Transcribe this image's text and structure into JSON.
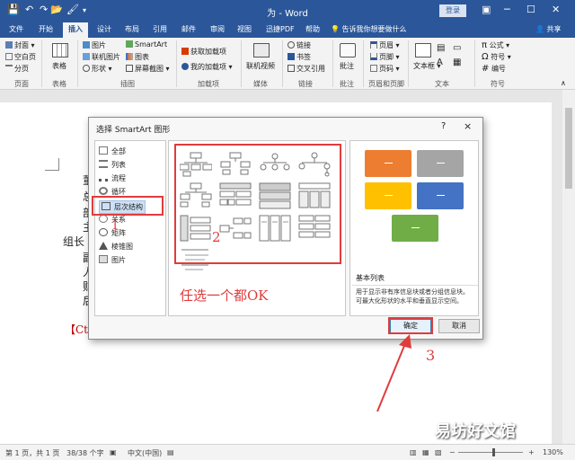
{
  "titlebar": {
    "doc_title": "为 - Word",
    "login": "登录",
    "quick_access": [
      "save-icon",
      "undo-icon",
      "redo-icon",
      "open-icon",
      "paint-icon",
      "dropdown-icon"
    ]
  },
  "tabs": [
    "文件",
    "开始",
    "插入",
    "设计",
    "布局",
    "引用",
    "邮件",
    "审阅",
    "视图",
    "迅捷PDF",
    "帮助"
  ],
  "tell_me": "告诉我你想要做什么",
  "share": "共享",
  "ribbon": {
    "pages": {
      "items": [
        "封面",
        "空白页",
        "分页"
      ],
      "group": "页面"
    },
    "tables": {
      "label": "表格",
      "group": "表格"
    },
    "illustrations": {
      "items": [
        "图片",
        "联机图片",
        "形状",
        "SmartArt",
        "图表",
        "屏幕截图"
      ],
      "group": "插图"
    },
    "addins": {
      "items": [
        "获取加载项",
        "我的加载项"
      ],
      "group": "加载项"
    },
    "media": {
      "label": "联机视频",
      "group": "媒体"
    },
    "links": {
      "items": [
        "链接",
        "书签",
        "交叉引用"
      ],
      "group": "链接"
    },
    "comments": {
      "label": "批注",
      "group": "批注"
    },
    "header_footer": {
      "items": [
        "页眉",
        "页脚",
        "页码"
      ],
      "group": "页眉和页脚"
    },
    "text": {
      "label": "文本框",
      "group": "文本"
    },
    "symbols": {
      "items": [
        "公式",
        "符号",
        "编号"
      ],
      "group": "符号"
    }
  },
  "doc_lines": [
    "董",
    "总",
    "部",
    "主",
    "组长",
    "副",
    "人",
    "财",
    "后",
    "【Ctrl"
  ],
  "dialog": {
    "title": "选择 SmartArt 图形",
    "help": "?",
    "close": "×",
    "categories": [
      "全部",
      "列表",
      "流程",
      "循环",
      "层次结构",
      "关系",
      "矩阵",
      "棱锥图",
      "图片"
    ],
    "selected_category": "层次结构",
    "preview_name": "基本列表",
    "preview_desc": "用于显示非有序信息块或者分组信息块。可最大化形状的水平和垂直显示空间。",
    "ok": "确定",
    "cancel": "取消",
    "tile_colors": [
      "#ed7d31",
      "#a5a5a5",
      "#ffc000",
      "#4472c4",
      "#70ad47"
    ]
  },
  "annotations": {
    "n1": "1",
    "n2": "2",
    "n3": "3",
    "note": "任选一个都OK"
  },
  "statusbar": {
    "page": "第 1 页，共 1 页",
    "words": "38/38 个字",
    "lang": "中文(中国)",
    "zoom": "130%"
  },
  "watermark": "易坊好文馆",
  "colors": {
    "word_blue": "#2b579a",
    "annotation_red": "#e03c3c"
  }
}
